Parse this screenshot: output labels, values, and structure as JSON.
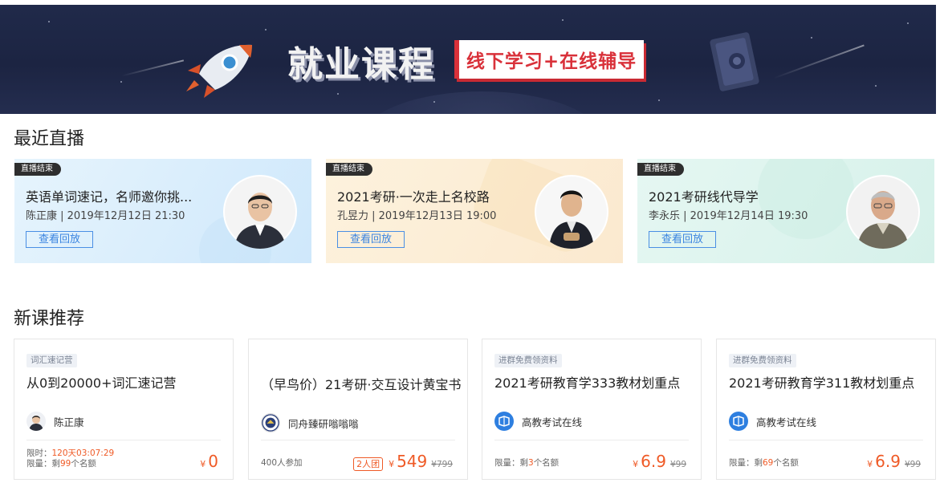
{
  "banner": {
    "title": "就业课程",
    "subtitle": "线下学习+在线辅导"
  },
  "live_section": {
    "title": "最近直播",
    "cards": [
      {
        "badge": "直播结束",
        "title": "英语单词速记，名师邀你挑...",
        "meta": "陈正康 | 2019年12月12日 21:30",
        "button": "查看回放",
        "bg": "#dceffb"
      },
      {
        "badge": "直播结束",
        "title": "2021考研·一次走上名校路",
        "meta": "孔昱力 | 2019年12月13日 19:00",
        "button": "查看回放",
        "bg": "#fcefd9"
      },
      {
        "badge": "直播结束",
        "title": "2021考研线代导学",
        "meta": "李永乐 | 2019年12月14日 19:30",
        "button": "查看回放",
        "bg": "#dff5ef"
      }
    ]
  },
  "course_section": {
    "title": "新课推荐",
    "cards": [
      {
        "tag": "词汇速记营",
        "title": "从0到20000+词汇速记营",
        "teacher": "陈正康",
        "limit_label": "限时：",
        "limit_value": "120天03:07:29",
        "quota_prefix": "限量：剩",
        "quota_count": "99",
        "quota_suffix": "个名额",
        "currency": "¥",
        "price": "0"
      },
      {
        "tag": "",
        "title": "（早鸟价）21考研·交互设计黄宝书",
        "teacher": "同舟臻研嗡嗡嗡",
        "participants": "400人参加",
        "group": "2人团",
        "currency": "¥",
        "price": "549",
        "original": "¥799"
      },
      {
        "tag": "进群免费领资料",
        "title": "2021考研教育学333教材划重点",
        "teacher": "高教考试在线",
        "quota_prefix": "限量：剩",
        "quota_count": "3",
        "quota_suffix": "个名额",
        "currency": "¥",
        "price": "6.9",
        "original": "¥99"
      },
      {
        "tag": "进群免费领资料",
        "title": "2021考研教育学311教材划重点",
        "teacher": "高教考试在线",
        "quota_prefix": "限量：剩",
        "quota_count": "69",
        "quota_suffix": "个名额",
        "currency": "¥",
        "price": "6.9",
        "original": "¥99"
      }
    ]
  },
  "colors": {
    "accent_red": "#ef5a26",
    "link_blue": "#3a84e0",
    "banner_bg": "#1f2847"
  }
}
